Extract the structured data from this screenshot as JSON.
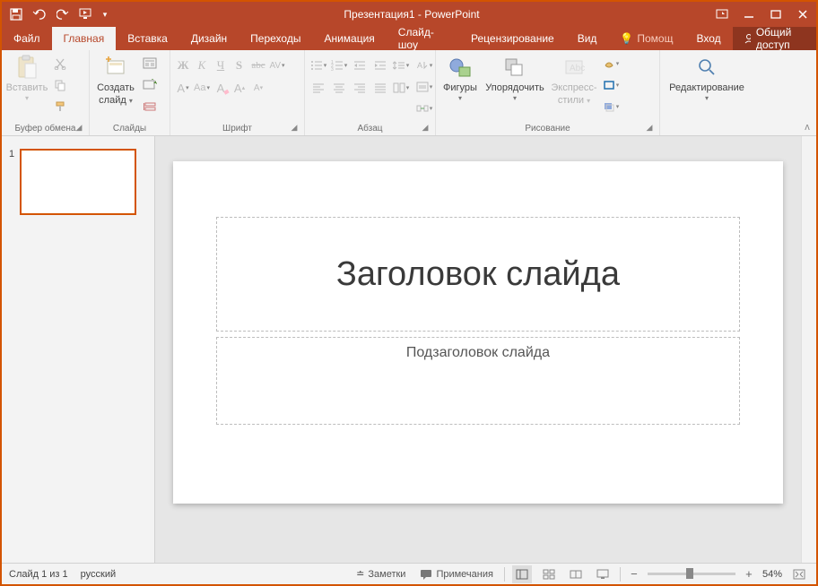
{
  "title": "Презентация1 - PowerPoint",
  "tabs": {
    "file": "Файл",
    "home": "Главная",
    "insert": "Вставка",
    "design": "Дизайн",
    "transitions": "Переходы",
    "animations": "Анимация",
    "slideshow": "Слайд-шоу",
    "review": "Рецензирование",
    "view": "Вид",
    "help": "Помощ",
    "signin": "Вход",
    "share": "Общий доступ"
  },
  "groups": {
    "clipboard": {
      "label": "Буфер обмена",
      "paste": "Вставить"
    },
    "slides": {
      "label": "Слайды",
      "newslide_l1": "Создать",
      "newslide_l2": "слайд"
    },
    "font": {
      "label": "Шрифт",
      "bold": "Ж",
      "italic": "К",
      "underline": "Ч",
      "shadow": "S",
      "strike": "abc",
      "spacing": "AV",
      "A": "A",
      "Aa": "Aa",
      "Aup": "A",
      "Adown": "A"
    },
    "paragraph": {
      "label": "Абзац"
    },
    "drawing": {
      "label": "Рисование",
      "shapes": "Фигуры",
      "arrange": "Упорядочить",
      "quickstyles_l1": "Экспресс-",
      "quickstyles_l2": "стили"
    },
    "editing": {
      "label": "",
      "edit_l1": "Редактирование"
    }
  },
  "slide": {
    "title_placeholder": "Заголовок слайда",
    "subtitle_placeholder": "Подзаголовок слайда",
    "thumb_number": "1"
  },
  "status": {
    "slide_counter": "Слайд 1 из 1",
    "language": "русский",
    "notes": "Заметки",
    "comments": "Примечания",
    "zoom": "54%"
  }
}
